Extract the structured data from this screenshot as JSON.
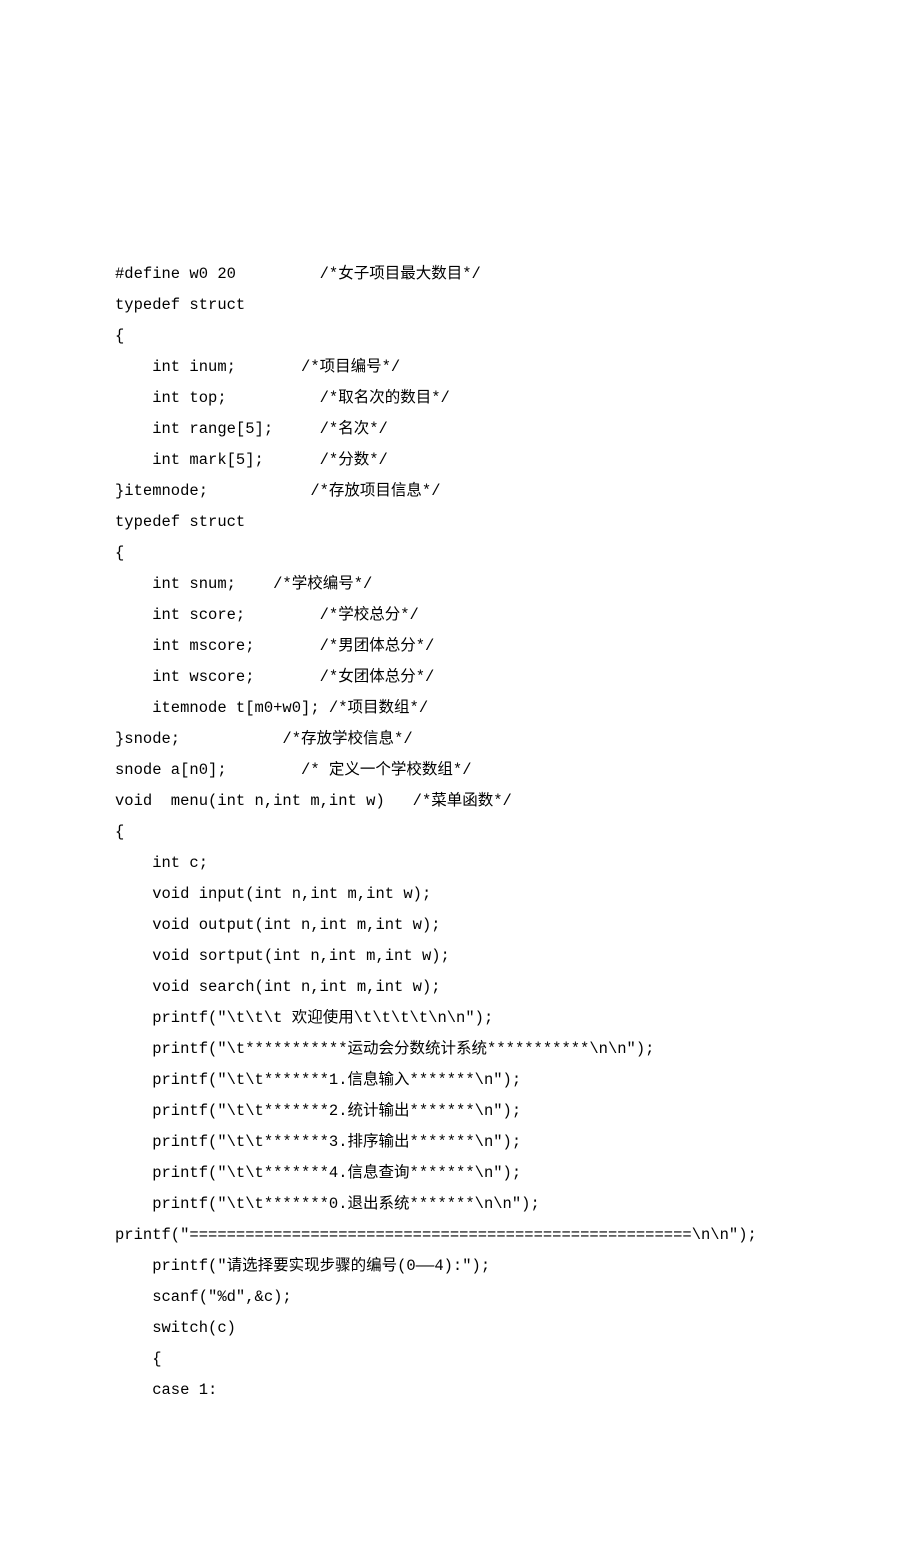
{
  "code": {
    "lines": [
      {
        "text": "#define w0 20         /*女子项目最大数目*/",
        "indent": 0
      },
      {
        "text": "typedef struct",
        "indent": 0
      },
      {
        "text": "{",
        "indent": 0
      },
      {
        "text": "int inum;       /*项目编号*/",
        "indent": 1
      },
      {
        "text": "int top;          /*取名次的数目*/",
        "indent": 1
      },
      {
        "text": "int range[5];     /*名次*/",
        "indent": 1
      },
      {
        "text": "int mark[5];      /*分数*/",
        "indent": 1
      },
      {
        "text": "}itemnode;           /*存放项目信息*/",
        "indent": 0
      },
      {
        "text": "typedef struct",
        "indent": 0
      },
      {
        "text": "{",
        "indent": 0
      },
      {
        "text": "int snum;    /*学校编号*/",
        "indent": 1
      },
      {
        "text": "int score;        /*学校总分*/",
        "indent": 1
      },
      {
        "text": "int mscore;       /*男团体总分*/",
        "indent": 1
      },
      {
        "text": "int wscore;       /*女团体总分*/",
        "indent": 1
      },
      {
        "text": "itemnode t[m0+w0]; /*项目数组*/",
        "indent": 1
      },
      {
        "text": "}snode;           /*存放学校信息*/",
        "indent": 0
      },
      {
        "text": "snode a[n0];        /* 定义一个学校数组*/",
        "indent": 0
      },
      {
        "text": "void  menu(int n,int m,int w)   /*菜单函数*/",
        "indent": 0
      },
      {
        "text": "{",
        "indent": 0
      },
      {
        "text": "int c;",
        "indent": 1
      },
      {
        "text": "void input(int n,int m,int w);",
        "indent": 1
      },
      {
        "text": "void output(int n,int m,int w);",
        "indent": 1
      },
      {
        "text": "void sortput(int n,int m,int w);",
        "indent": 1
      },
      {
        "text": "void search(int n,int m,int w);",
        "indent": 1
      },
      {
        "text": "printf(\"\\t\\t\\t 欢迎使用\\t\\t\\t\\t\\n\\n\");",
        "indent": 1
      },
      {
        "text": "printf(\"\\t***********运动会分数统计系统***********\\n\\n\");",
        "indent": 1
      },
      {
        "text": "printf(\"\\t\\t*******1.信息输入*******\\n\");",
        "indent": 1
      },
      {
        "text": "printf(\"\\t\\t*******2.统计输出*******\\n\");",
        "indent": 1
      },
      {
        "text": "printf(\"\\t\\t*******3.排序输出*******\\n\");",
        "indent": 1
      },
      {
        "text": "printf(\"\\t\\t*******4.信息查询*******\\n\");",
        "indent": 1
      },
      {
        "text": "printf(\"\\t\\t*******0.退出系统*******\\n\\n\");",
        "indent": 1
      },
      {
        "text": "",
        "indent": 0
      },
      {
        "text": "printf(\"======================================================\\n\\n\");",
        "indent": 0
      },
      {
        "text": "printf(\"请选择要实现步骤的编号(0——4):\");",
        "indent": 1
      },
      {
        "text": "scanf(\"%d\",&c);",
        "indent": 1
      },
      {
        "text": "switch(c)",
        "indent": 1
      },
      {
        "text": "{",
        "indent": 1
      },
      {
        "text": "case 1:",
        "indent": 1
      }
    ]
  }
}
